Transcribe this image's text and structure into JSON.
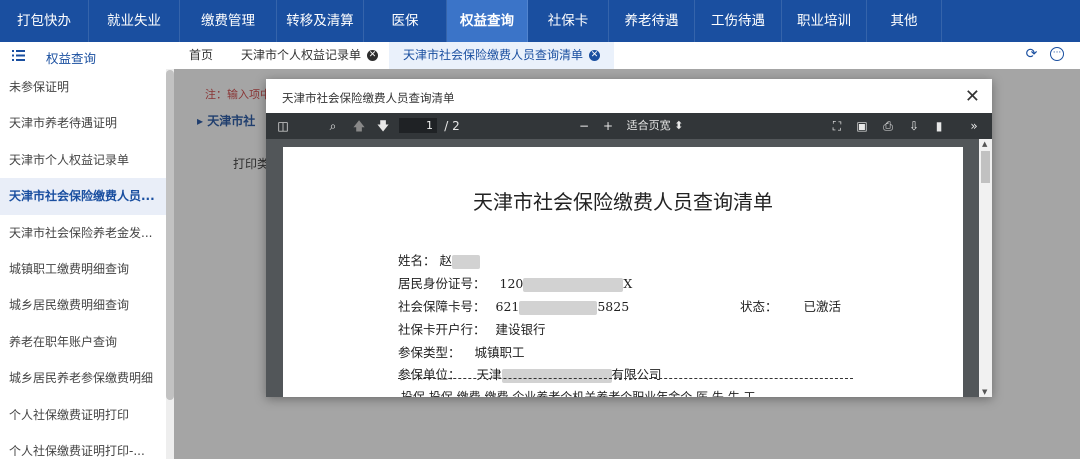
{
  "top_nav": [
    "打包快办",
    "就业失业",
    "缴费管理",
    "转移及清算",
    "医保",
    "权益查询",
    "社保卡",
    "养老待遇",
    "工伤待遇",
    "职业培训",
    "其他"
  ],
  "sidebar": {
    "title": "权益查询",
    "items": [
      "未参保证明",
      "天津市养老待遇证明",
      "天津市个人权益记录单",
      "天津市社会保险缴费人员...",
      "天津市社会保险养老金发...",
      "城镇职工缴费明细查询",
      "城乡居民缴费明细查询",
      "养老在职年账户查询",
      "城乡居民养老参保缴费明细",
      "个人社保缴费证明打印",
      "个人社保缴费证明打印-..."
    ]
  },
  "tabs": {
    "home": "首页",
    "tab1": "天津市个人权益记录单",
    "tab2": "天津市社会保险缴费人员查询清单"
  },
  "content": {
    "note": "注：输入项中",
    "section": "天津市社",
    "print_label": "打印类"
  },
  "dialog": {
    "title": "天津市社会保险缴费人员查询清单"
  },
  "pdf_toolbar": {
    "page_current": "1",
    "page_total": "/ 2",
    "zoom": "适合页宽"
  },
  "document": {
    "title": "天津市社会保险缴费人员查询清单",
    "name_label": "姓名：",
    "name_value": "赵",
    "id_label": "居民身份证号：",
    "id_prefix": "120",
    "id_suffix": "X",
    "card_label": "社会保障卡号：",
    "card_prefix": "621",
    "card_suffix": "5825",
    "status_label": "状态：",
    "status_value": "已激活",
    "bank_label": "社保卡开户行：",
    "bank_value": "建设银行",
    "type_label": "参保类型：",
    "type_value": "城镇职工",
    "unit_label": "参保单位：",
    "unit_prefix": "天津",
    "unit_suffix": "有限公司",
    "table_header": "投保 投保 缴费 缴费 企业养老个机关养老个职业年金个 医 失 生 工"
  }
}
